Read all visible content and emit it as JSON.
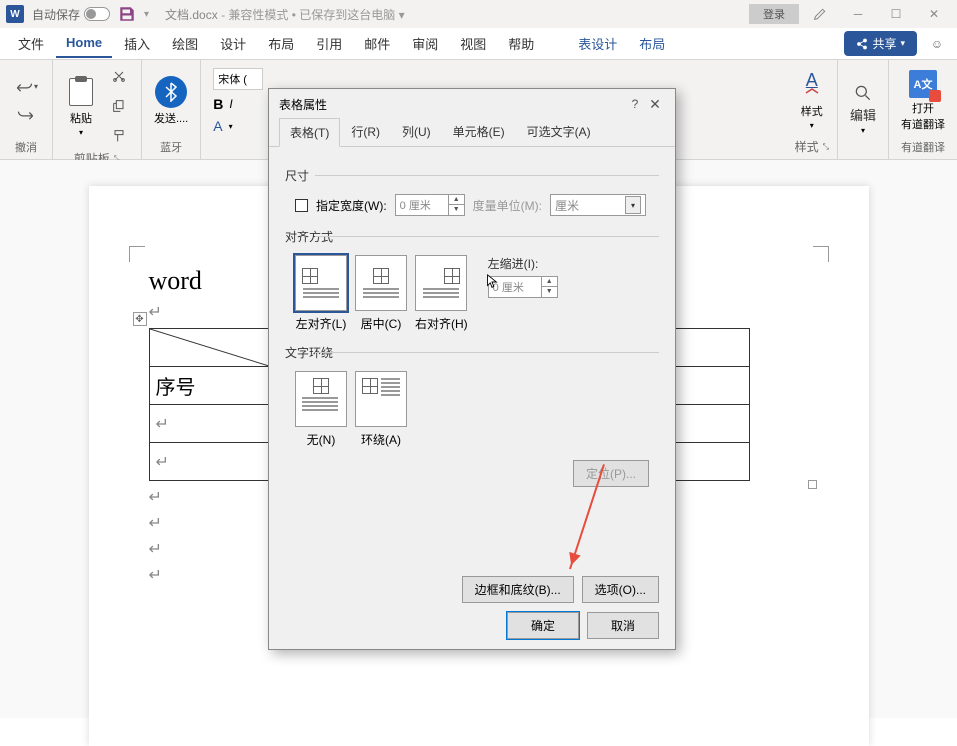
{
  "titlebar": {
    "autosave": "自动保存",
    "doc": "文档.docx",
    "mode": "兼容性模式 • 已保存到这台电脑",
    "login": "登录"
  },
  "menu": {
    "file": "文件",
    "home": "Home",
    "insert": "插入",
    "draw": "绘图",
    "design": "设计",
    "layout": "布局",
    "refs": "引用",
    "mail": "邮件",
    "review": "审阅",
    "view": "视图",
    "help": "帮助",
    "tabledesign": "表设计",
    "tablelayout": "布局",
    "share": "共享"
  },
  "ribbon": {
    "undo": "撤消",
    "clipboard": "剪贴板",
    "paste": "粘贴",
    "bluetooth": "蓝牙",
    "send": "发送....",
    "font": "宋体 (",
    "styles": "样式",
    "styles_label": "样式",
    "edit": "编辑",
    "youdao": "有道翻译",
    "youdao_open": "打开\n有道翻译"
  },
  "document": {
    "text": "word",
    "cell": "序号"
  },
  "dialog": {
    "title": "表格属性",
    "tabs": {
      "table": "表格(T)",
      "row": "行(R)",
      "col": "列(U)",
      "cell": "单元格(E)",
      "alt": "可选文字(A)"
    },
    "size": "尺寸",
    "specify_width": "指定宽度(W):",
    "width_val": "0 厘米",
    "unit_label": "度量单位(M):",
    "unit_val": "厘米",
    "align": "对齐方式",
    "align_left": "左对齐(L)",
    "align_center": "居中(C)",
    "align_right": "右对齐(H)",
    "indent": "左缩进(I):",
    "indent_val": "0 厘米",
    "wrap": "文字环绕",
    "wrap_none": "无(N)",
    "wrap_around": "环绕(A)",
    "position": "定位(P)...",
    "borders": "边框和底纹(B)...",
    "options": "选项(O)...",
    "ok": "确定",
    "cancel": "取消"
  }
}
